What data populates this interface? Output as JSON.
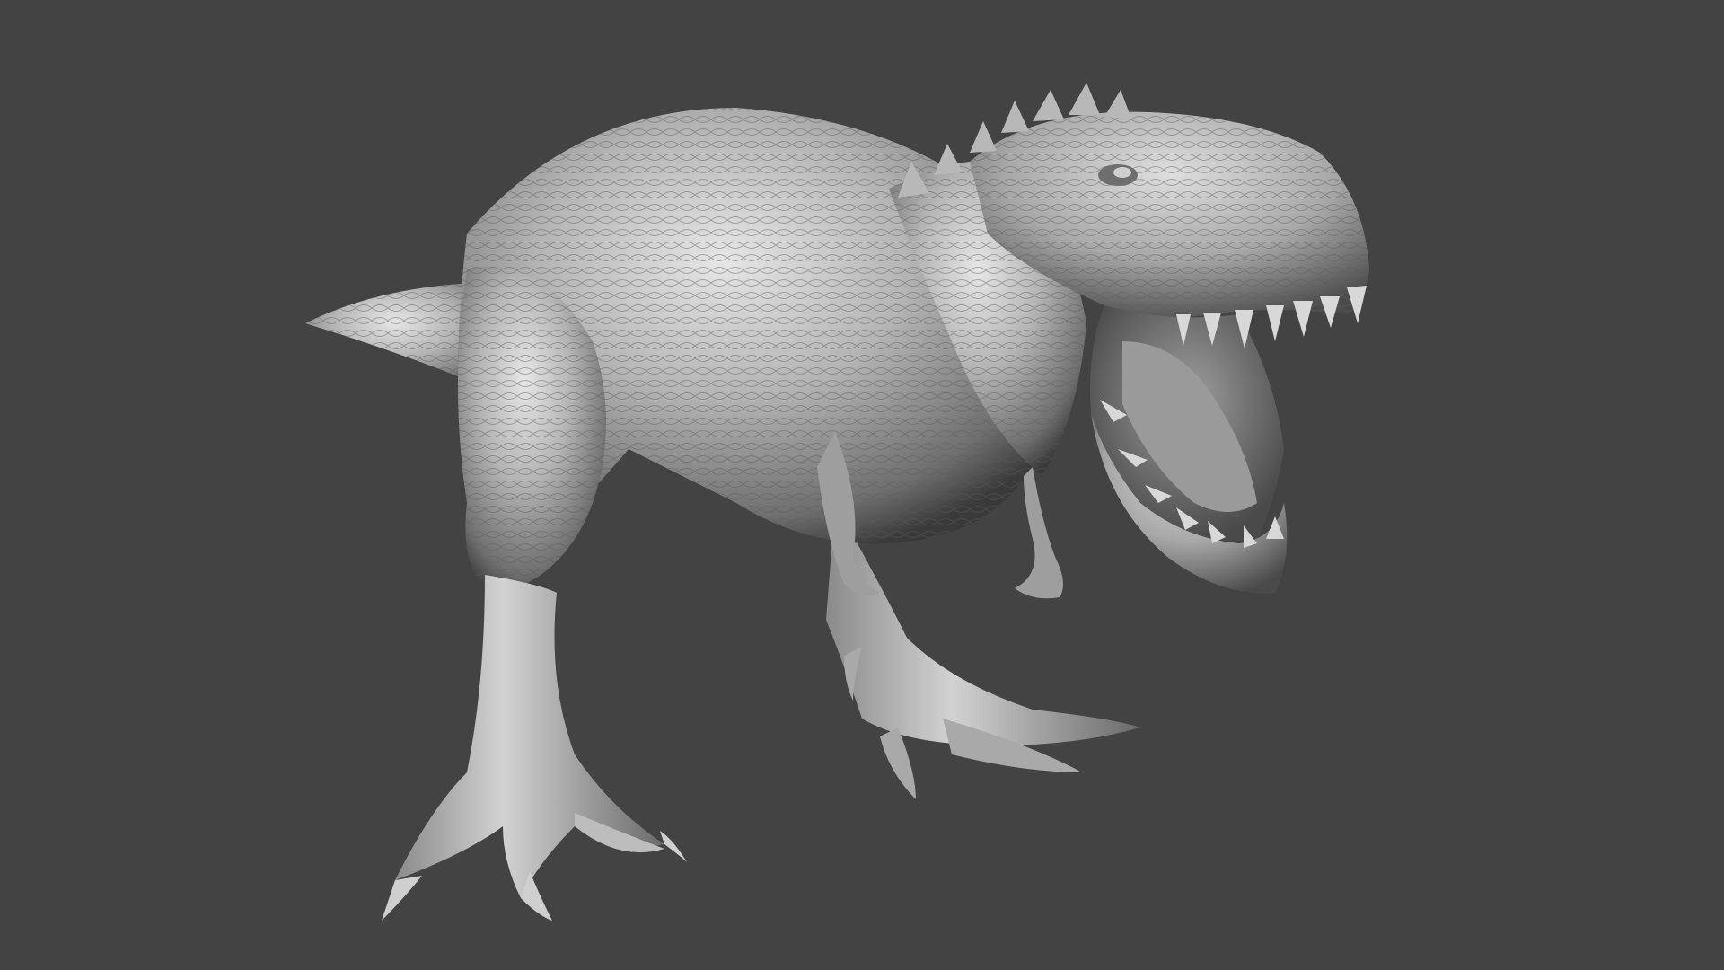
{
  "viewport": {
    "background_color": "#434343"
  },
  "model": {
    "subject": "tyrannosaurus-sculpt",
    "material_color": "#b4b4b4",
    "highlight_color": "#e6e6e6",
    "shadow_color": "#3a3a3a"
  }
}
